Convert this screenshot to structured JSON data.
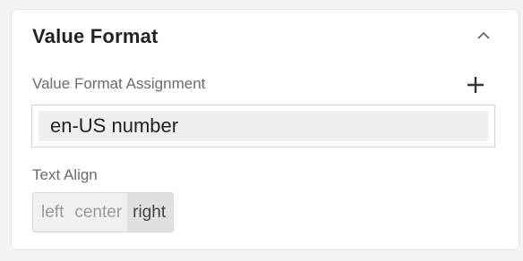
{
  "panel": {
    "title": "Value Format",
    "collapse_icon": "chevron-up-icon"
  },
  "value_format_assignment": {
    "label": "Value Format Assignment",
    "add_icon": "plus-icon",
    "selected_value": "en-US number"
  },
  "text_align": {
    "label": "Text Align",
    "options": [
      "left",
      "center",
      "right"
    ],
    "selected": "right"
  },
  "colors": {
    "active_option_bg": "#e0e0e0",
    "inactive_option_text": "#9a9a9a",
    "active_option_text": "#444444"
  }
}
